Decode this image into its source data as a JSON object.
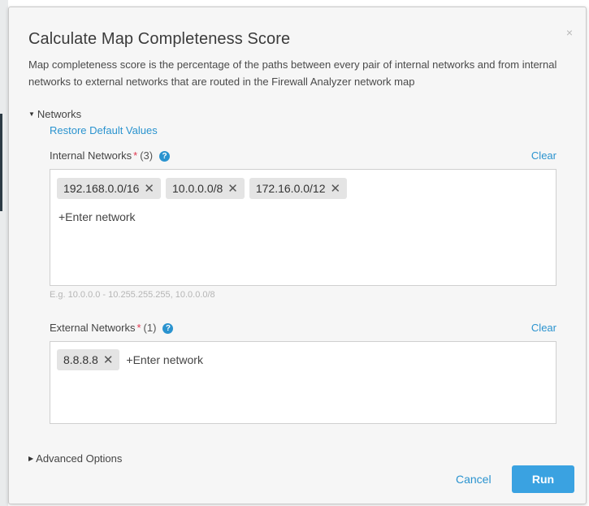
{
  "dialog": {
    "title": "Calculate Map Completeness Score",
    "close_icon": "×",
    "description": "Map completeness score is the percentage of the paths between every pair of internal networks and from internal networks to external networks that are routed in the Firewall Analyzer network map"
  },
  "networks_section": {
    "label": "Networks",
    "restore_link": "Restore Default Values",
    "internal": {
      "label": "Internal Networks",
      "required_mark": "*",
      "count": "(3)",
      "help_icon": "?",
      "clear": "Clear",
      "tags": [
        "192.168.0.0/16",
        "10.0.0.0/8",
        "172.16.0.0/12"
      ],
      "enter_placeholder": "+Enter network",
      "hint": "E.g. 10.0.0.0 - 10.255.255.255, 10.0.0.0/8"
    },
    "external": {
      "label": "External Networks",
      "required_mark": "*",
      "count": "(1)",
      "help_icon": "?",
      "clear": "Clear",
      "tags": [
        "8.8.8.8"
      ],
      "enter_placeholder": "+Enter network"
    }
  },
  "advanced": {
    "label": "Advanced Options"
  },
  "footer": {
    "cancel": "Cancel",
    "run": "Run"
  },
  "tag_remove_icon": "✕",
  "colors": {
    "accent": "#2a93cf",
    "run_button": "#3aa2e1",
    "required": "#e0364e"
  }
}
